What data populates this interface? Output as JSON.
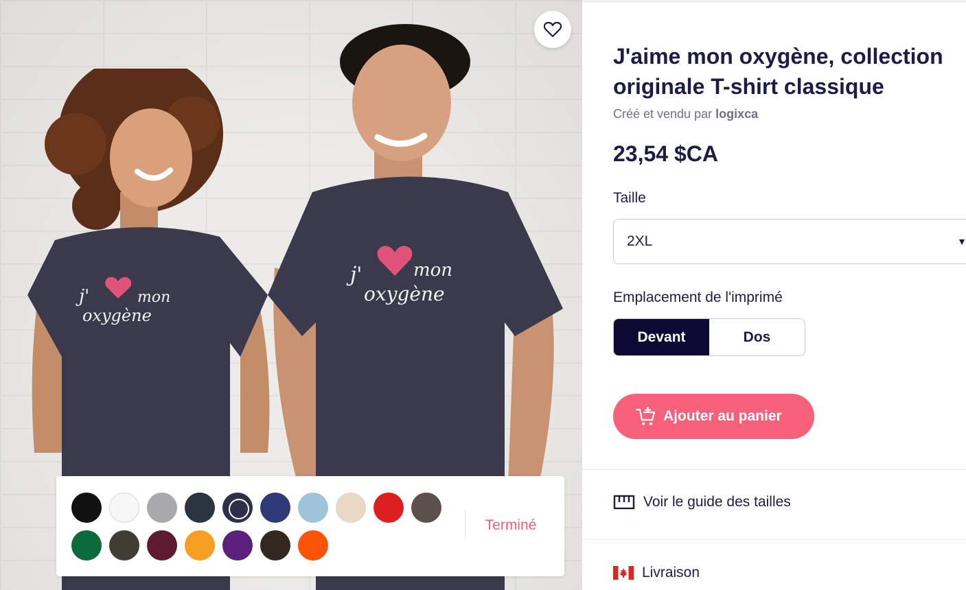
{
  "product": {
    "title": "J'aime mon oxygène, collection originale T-shirt classique",
    "seller_prefix": "Créé et vendu par",
    "seller_name": "logixca",
    "price": "23,54 $CA"
  },
  "shirt_print": {
    "line1_left": "j'",
    "line1_right": "mon",
    "line2": "oxygène"
  },
  "size": {
    "label": "Taille",
    "selected": "2XL"
  },
  "placement": {
    "label": "Emplacement de l'imprimé",
    "options": [
      "Devant",
      "Dos"
    ],
    "selected": "Devant"
  },
  "cart": {
    "label": "Ajouter au panier"
  },
  "links": {
    "size_guide": "Voir le guide des tailles",
    "shipping": "Livraison"
  },
  "color_panel": {
    "done_label": "Terminé",
    "colors": [
      "#111111",
      "#f7f7f7",
      "#a9a9ab",
      "#2b3540",
      "#2f3047",
      "#2f3a78",
      "#9fc3da",
      "#e8d8c4",
      "#dd1f21",
      "#5c504b",
      "#0b6b3a",
      "#403d32",
      "#5e1a30",
      "#f5a023",
      "#5b1f7c",
      "#32281f",
      "#fb5308"
    ],
    "selected_index": 4
  },
  "theme": {
    "accent": "#f7607b",
    "dark": "#0c0a35",
    "shirt": "#3a3a4c"
  }
}
